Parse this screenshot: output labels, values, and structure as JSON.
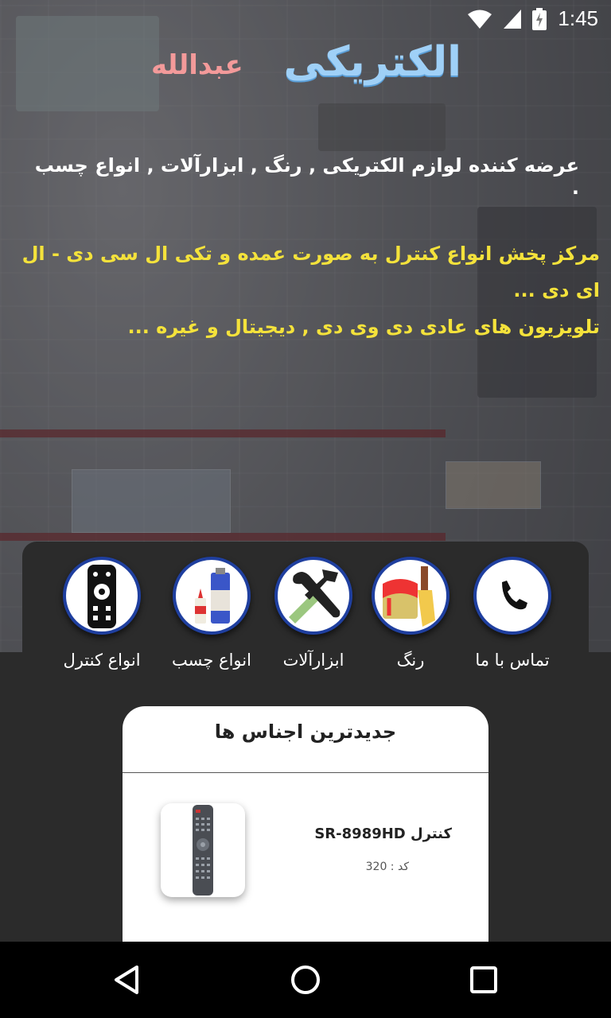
{
  "status_bar": {
    "time": "1:45"
  },
  "logo": {
    "main": "الکتریکی",
    "sub": "عبدالله"
  },
  "tagline": "عرضه کننده لوازم الکتریکی , رنگ , ابزارآلات , انواع چسب .",
  "description": {
    "line1": "مرکز پخش انواع کنترل به صورت عمده و تکی ال سی دی - ال ای دی ...",
    "line2": "تلویزیون های عادی دی وی دی , دیجیتال و غیره ..."
  },
  "categories": [
    {
      "label": "تماس با ما",
      "icon": "phone-icon"
    },
    {
      "label": "رنگ",
      "icon": "paint-bucket-icon"
    },
    {
      "label": "ابزارآلات",
      "icon": "tools-icon"
    },
    {
      "label": "انواع چسب",
      "icon": "glue-icon"
    },
    {
      "label": "انواع کنترل",
      "icon": "remote-control-icon"
    }
  ],
  "newest_products": {
    "title": "جدیدترین اجناس ها",
    "items": [
      {
        "name": "کنترل SR-8989HD",
        "code_label": "کد : 320"
      }
    ]
  },
  "nav": {
    "icons": [
      "back-icon",
      "home-icon",
      "recents-icon"
    ]
  },
  "colors": {
    "accent_yellow": "#f4e23b",
    "circle_border": "#1f3f9f",
    "logo_blue": "#9fd0f7",
    "logo_pink": "#f39a9a"
  }
}
